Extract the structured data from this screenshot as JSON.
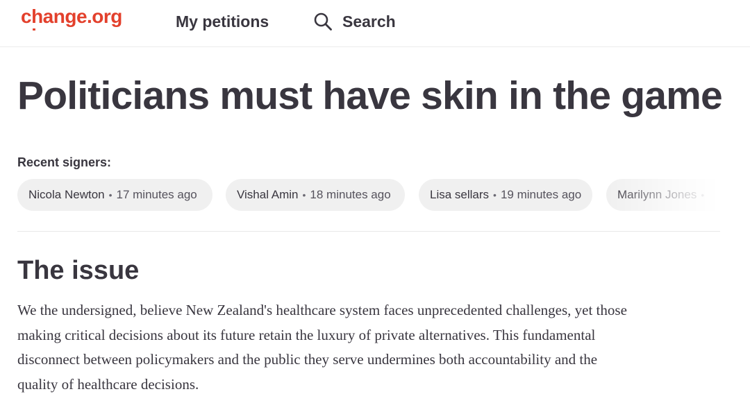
{
  "brand": {
    "logo_text": "change.org",
    "color": "#e3402c"
  },
  "nav": {
    "my_petitions": "My petitions",
    "search": "Search",
    "search_icon": "search-icon"
  },
  "petition": {
    "title": "Politicians must have skin in the game"
  },
  "recent_signers": {
    "label": "Recent signers:",
    "items": [
      {
        "name": "Nicola Newton",
        "time": "17 minutes ago"
      },
      {
        "name": "Vishal Amin",
        "time": "18 minutes ago"
      },
      {
        "name": "Lisa sellars",
        "time": "19 minutes ago"
      },
      {
        "name": "Marilynn Jones",
        "time": ""
      }
    ]
  },
  "issue": {
    "heading": "The issue",
    "lines": [
      "We the undersigned, believe New Zealand's healthcare system faces unprecedented challenges, yet those",
      "making critical decisions about its future retain the luxury of private alternatives. This fundamental",
      "disconnect between policymakers and the public they serve undermines both accountability and the",
      "quality of healthcare decisions."
    ]
  }
}
